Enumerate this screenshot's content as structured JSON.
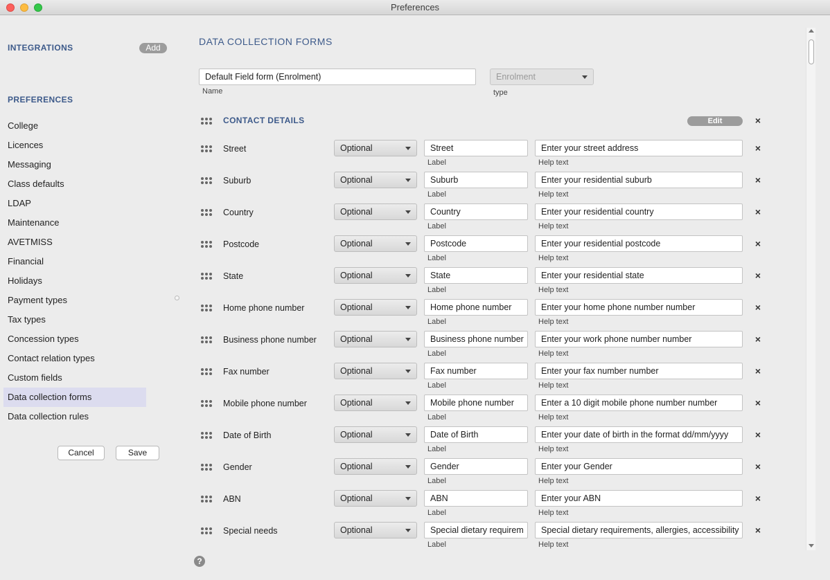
{
  "window": {
    "title": "Preferences"
  },
  "sidebar": {
    "integrations_heading": "INTEGRATIONS",
    "add_label": "Add",
    "preferences_heading": "PREFERENCES",
    "items": [
      {
        "label": "College"
      },
      {
        "label": "Licences"
      },
      {
        "label": "Messaging"
      },
      {
        "label": "Class defaults"
      },
      {
        "label": "LDAP"
      },
      {
        "label": "Maintenance"
      },
      {
        "label": "AVETMISS"
      },
      {
        "label": "Financial"
      },
      {
        "label": "Holidays"
      },
      {
        "label": "Payment types"
      },
      {
        "label": "Tax types"
      },
      {
        "label": "Concession types"
      },
      {
        "label": "Contact relation types"
      },
      {
        "label": "Custom fields"
      },
      {
        "label": "Data collection forms",
        "active": true
      },
      {
        "label": "Data collection rules"
      }
    ],
    "cancel_label": "Cancel",
    "save_label": "Save"
  },
  "main": {
    "title": "DATA COLLECTION FORMS",
    "form_name": {
      "value": "Default Field form (Enrolment)",
      "caption": "Name"
    },
    "form_type": {
      "value": "Enrolment",
      "caption": "type"
    },
    "section": {
      "title": "CONTACT DETAILS",
      "edit_label": "Edit"
    },
    "label_caption": "Label",
    "help_caption": "Help text",
    "fields": [
      {
        "name": "Street",
        "requirement": "Optional",
        "label": "Street",
        "help": "Enter your street address"
      },
      {
        "name": "Suburb",
        "requirement": "Optional",
        "label": "Suburb",
        "help": "Enter your residential suburb"
      },
      {
        "name": "Country",
        "requirement": "Optional",
        "label": "Country",
        "help": "Enter your residential country"
      },
      {
        "name": "Postcode",
        "requirement": "Optional",
        "label": "Postcode",
        "help": "Enter your residential postcode"
      },
      {
        "name": "State",
        "requirement": "Optional",
        "label": "State",
        "help": "Enter your residential state"
      },
      {
        "name": "Home phone number",
        "requirement": "Optional",
        "label": "Home phone number",
        "help": "Enter your home phone number number"
      },
      {
        "name": "Business phone number",
        "requirement": "Optional",
        "label": "Business phone number",
        "help": "Enter your work phone number number"
      },
      {
        "name": "Fax number",
        "requirement": "Optional",
        "label": "Fax number",
        "help": "Enter your fax number number"
      },
      {
        "name": "Mobile phone number",
        "requirement": "Optional",
        "label": "Mobile phone number",
        "help": "Enter a 10 digit mobile phone number number"
      },
      {
        "name": "Date of Birth",
        "requirement": "Optional",
        "label": "Date of Birth",
        "help": "Enter your date of birth in the format dd/mm/yyyy"
      },
      {
        "name": "Gender",
        "requirement": "Optional",
        "label": "Gender",
        "help": "Enter your Gender"
      },
      {
        "name": "ABN",
        "requirement": "Optional",
        "label": "ABN",
        "help": "Enter your ABN"
      },
      {
        "name": "Special needs",
        "requirement": "Optional",
        "label": "Special dietary requirem",
        "help": "Special dietary requirements, allergies, accessibility"
      }
    ]
  }
}
